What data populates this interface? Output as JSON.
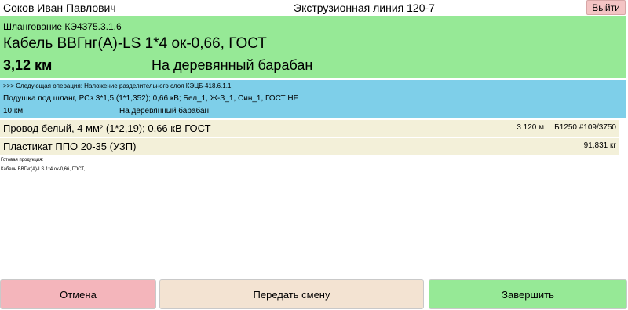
{
  "header": {
    "user_name": "Соков Иван Павлович",
    "line_title": "Экструзионная линия 120-7",
    "exit_label": "Выйти"
  },
  "current_operation": {
    "code": "Шлангование КЭ4375.3.1.6",
    "product": "Кабель ВВГнг(А)-LS 1*4 ок-0,66, ГОСТ",
    "quantity": "3,12 км",
    "package": "На деревянный барабан"
  },
  "next_operation": {
    "title": ">>> Следующая операция: Наложение разделительного слоя КЭЦБ-418.6.1.1",
    "product": "Подушка под шланг, РСз 3*1,5 (1*1,352); 0,66 кВ; Бел_1, Ж-З_1, Син_1,  ГОСТ HF",
    "quantity": "10 км",
    "package": "На деревянный барабан"
  },
  "materials": [
    {
      "name": "Провод белый, 4 мм² (1*2,19); 0,66 кВ ГОСТ",
      "quantity": "3 120 м",
      "location": "Б1250 #109/3750"
    },
    {
      "name": "Пластикат ППО 20-35 (УЗП)",
      "quantity": "91,831 кг",
      "location": ""
    }
  ],
  "finished": {
    "label": "Готовая продукция:",
    "item": "Кабель ВВГнг(А)-LS 1*4 ок-0,66, ГОСТ,"
  },
  "actions": {
    "cancel_label": "Отмена",
    "handover_label": "Передать смену",
    "finish_label": "Завершить"
  }
}
